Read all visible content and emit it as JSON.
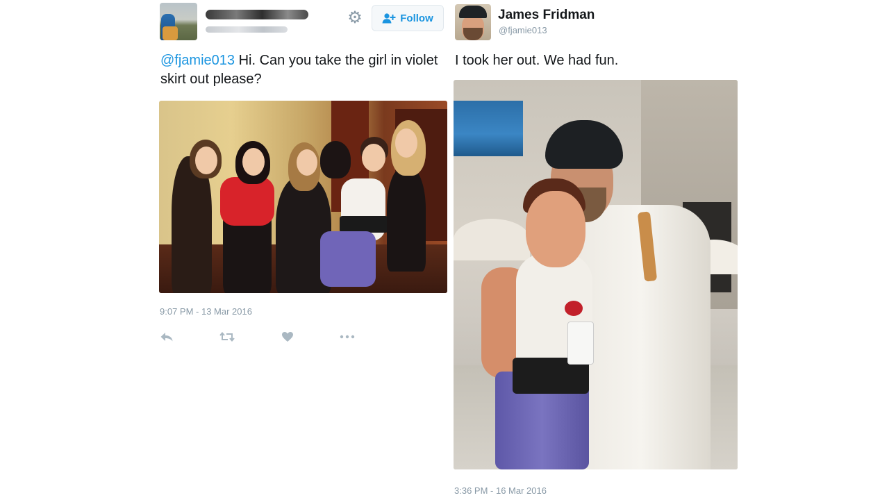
{
  "left_tweet": {
    "follow_label": "Follow",
    "mention": "@fjamie013",
    "text": " Hi. Can you take the girl in violet skirt out please?",
    "timestamp": "9:07 PM - 13 Mar 2016",
    "actions": {
      "reply_icon": "reply-icon",
      "retweet_icon": "retweet-icon",
      "like_icon": "heart-icon",
      "more_icon": "more-icon"
    }
  },
  "right_tweet": {
    "author_name": "James Fridman",
    "author_handle": "@fjamie013",
    "text": "I took her out. We had fun.",
    "timestamp": "3:36 PM - 16 Mar 2016"
  },
  "colors": {
    "link_blue": "#1b95e0",
    "meta_gray": "#8899a6",
    "icon_gray": "#aab8c2"
  }
}
